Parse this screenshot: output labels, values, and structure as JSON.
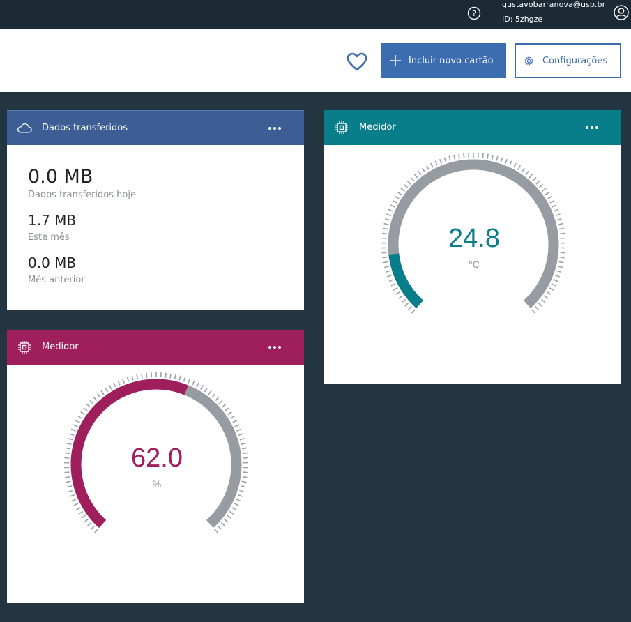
{
  "user": {
    "email": "gustavobarranova@usp.br",
    "id": "ID: 5zhgze"
  },
  "toolbar": {
    "add_label": "Incluir novo cartão",
    "config_label": "Configurações"
  },
  "data_card": {
    "title": "Dados transferidos",
    "today_value": "0.0 MB",
    "today_label": "Dados transferidos hoje",
    "month_value": "1.7 MB",
    "month_label": "Este mês",
    "prev_value": "0.0 MB",
    "prev_label": "Mês anterior"
  },
  "temp_card": {
    "title": "Medidor",
    "value": "24.8",
    "unit": "°C",
    "fill_fraction": 0.15
  },
  "hum_card": {
    "title": "Medidor",
    "value": "62.0",
    "unit": "%",
    "fill_fraction": 0.58
  },
  "colors": {
    "temp_accent": "#087e8b",
    "hum_accent": "#9e1f5c",
    "data_header": "#3d5e94",
    "button_blue": "#3c6db0",
    "track": "#969ca1"
  }
}
